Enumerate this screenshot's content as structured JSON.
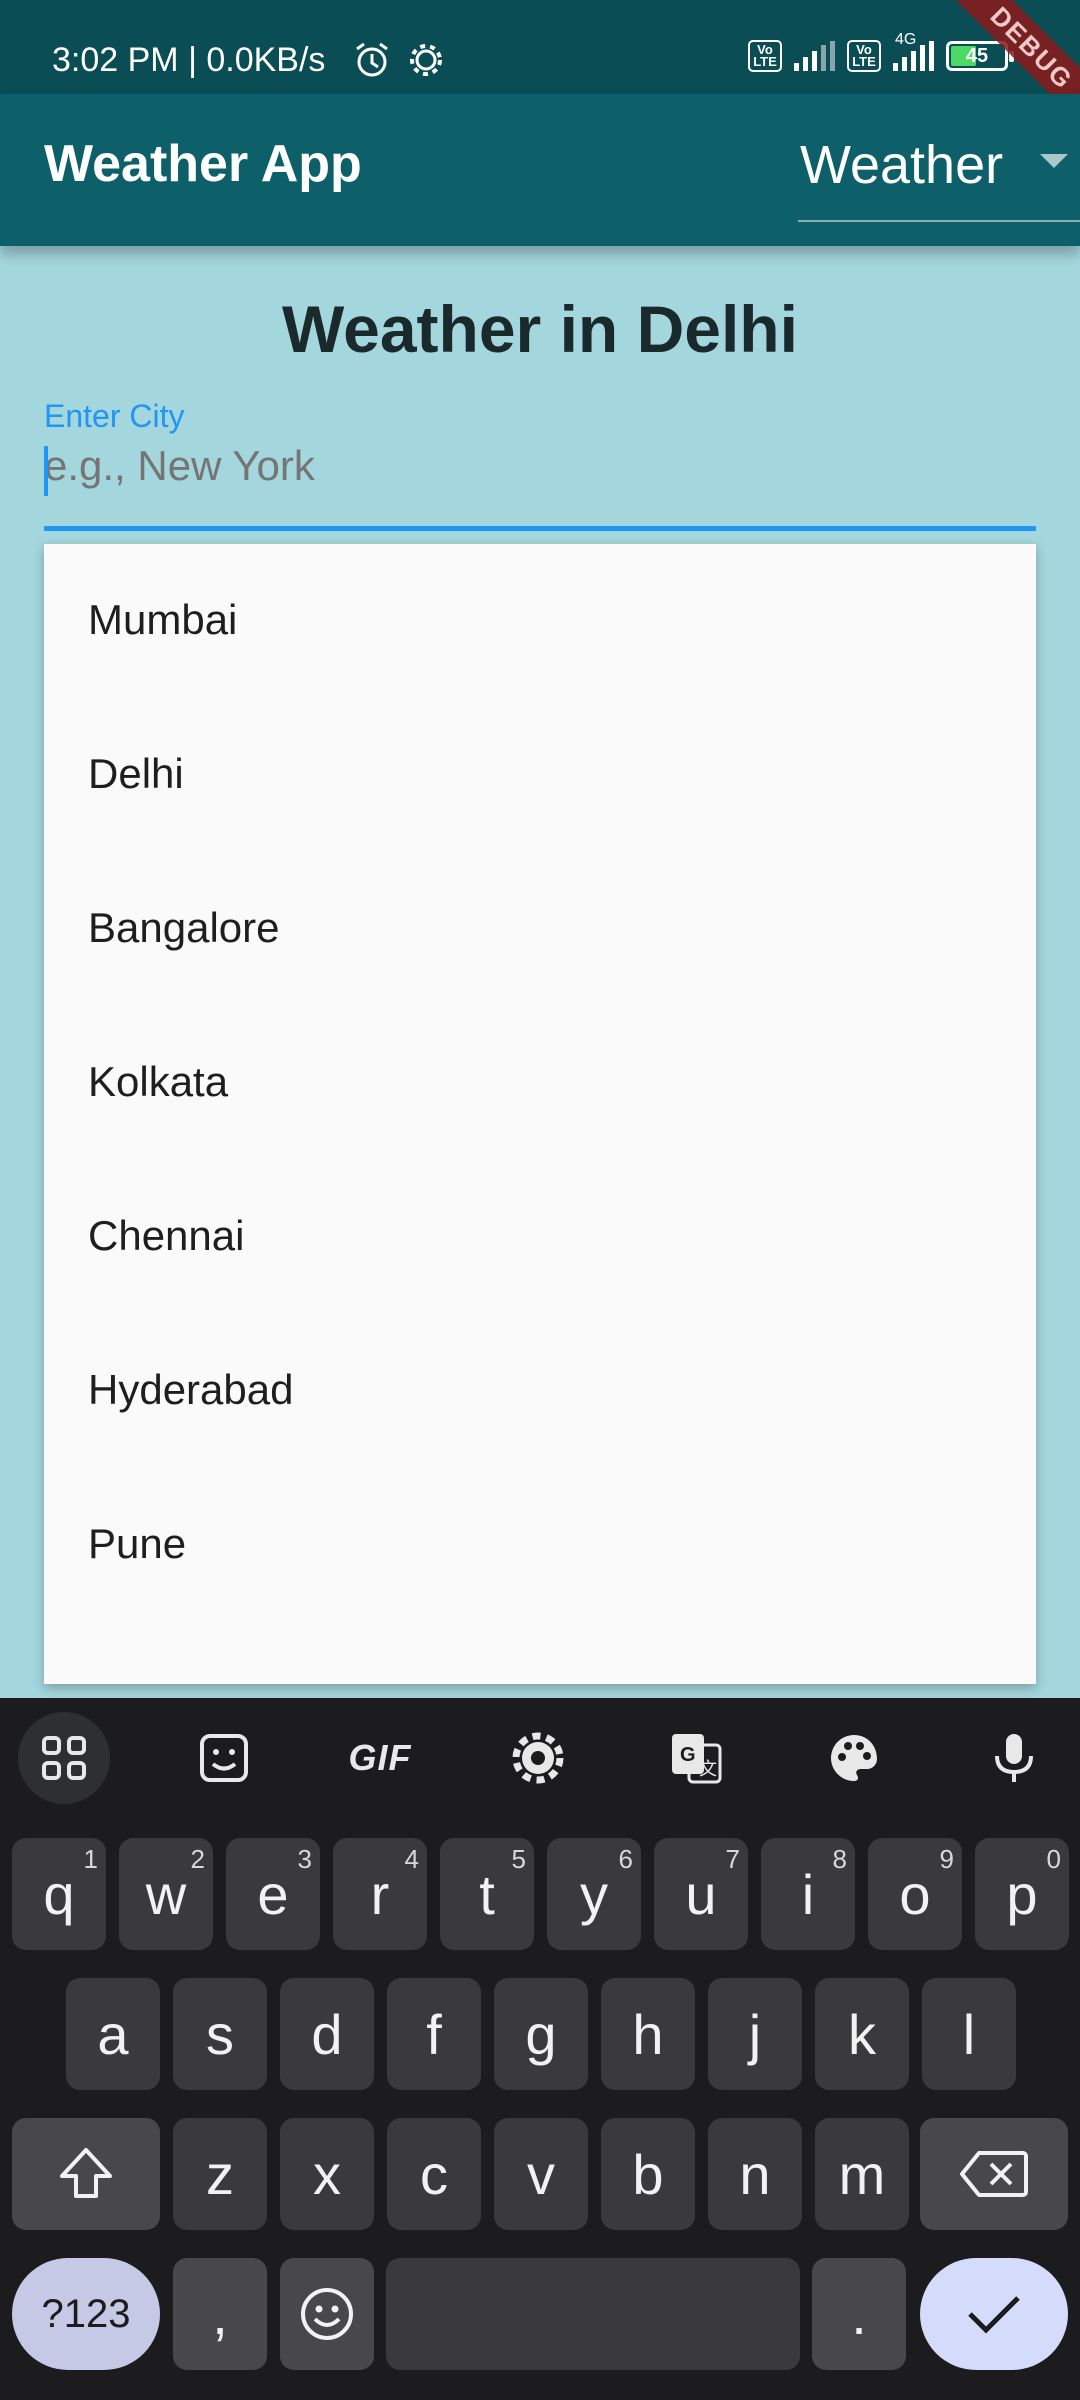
{
  "status_bar": {
    "time_speed": "3:02 PM | 0.0KB/s",
    "volte1": "Vo LTE",
    "volte2": "Vo LTE",
    "network": "4G",
    "battery": "45",
    "debug_banner": "DEBUG"
  },
  "app_bar": {
    "title": "Weather App",
    "dropdown_value": "Weather"
  },
  "main": {
    "heading": "Weather in Delhi",
    "city_field": {
      "label": "Enter City",
      "placeholder": "e.g., New York",
      "value": ""
    },
    "suggestions": [
      "Mumbai",
      "Delhi",
      "Bangalore",
      "Kolkata",
      "Chennai",
      "Hyderabad",
      "Pune"
    ]
  },
  "keyboard": {
    "toolbar": [
      "apps-grid-icon",
      "sticker-icon",
      "GIF",
      "gear-icon",
      "translate-icon",
      "palette-icon",
      "microphone-icon"
    ],
    "row1": [
      {
        "key": "q",
        "sup": "1"
      },
      {
        "key": "w",
        "sup": "2"
      },
      {
        "key": "e",
        "sup": "3"
      },
      {
        "key": "r",
        "sup": "4"
      },
      {
        "key": "t",
        "sup": "5"
      },
      {
        "key": "y",
        "sup": "6"
      },
      {
        "key": "u",
        "sup": "7"
      },
      {
        "key": "i",
        "sup": "8"
      },
      {
        "key": "o",
        "sup": "9"
      },
      {
        "key": "p",
        "sup": "0"
      }
    ],
    "row2": [
      "a",
      "s",
      "d",
      "f",
      "g",
      "h",
      "j",
      "k",
      "l"
    ],
    "row3": [
      "z",
      "x",
      "c",
      "v",
      "b",
      "n",
      "m"
    ],
    "symbols_label": "?123",
    "comma": ",",
    "period": "."
  },
  "colors": {
    "status_bar": "#0a4d55",
    "app_bar": "#0d5f69",
    "background": "#a3d6dd",
    "accent": "#2196f3",
    "keyboard": "#1c1c1e"
  }
}
